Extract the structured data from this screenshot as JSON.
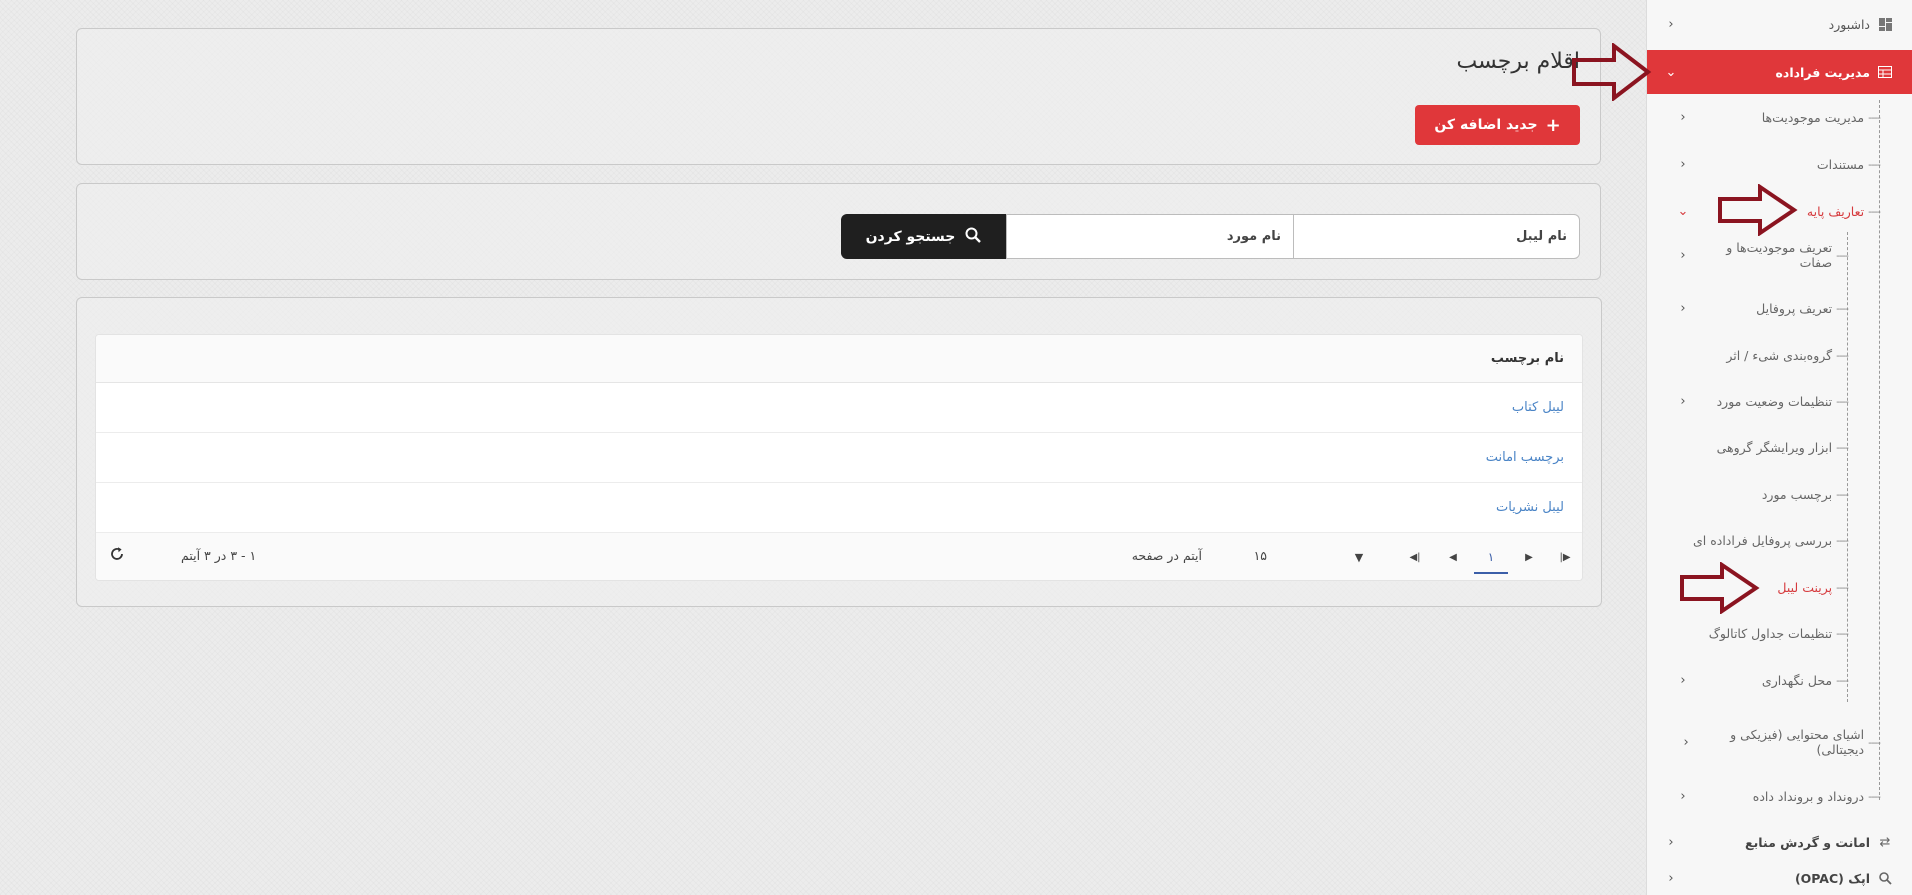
{
  "sidebar": {
    "dashboard": "داشبورد",
    "metadata": "مدیریت فراداده",
    "entity_mgmt": "مدیریت موجودیت‌ها",
    "documents": "مستندات",
    "basic_defs": "تعاریف پایه",
    "sub": {
      "entity_defs": "تعریف موجودیت‌ها و صفات",
      "profile_def": "تعریف پروفایل",
      "object_grouping": "گروه‌بندی شیء / اثر",
      "item_status": "تنظیمات وضعیت مورد",
      "bulk_editor": "ابزار ویرایشگر گروهی",
      "item_label": "برچسب مورد",
      "profile_review": "بررسی پروفایل فراداده ای",
      "label_print": "پرینت لیبل",
      "catalog_tables": "تنظیمات جداول کاتالوگ",
      "storage": "محل نگهداری"
    },
    "content_objects": "اشیای محتوایی (فیزیکی و دیجیتالی)",
    "data_io": "درونداد و برونداد داده",
    "circulation": "امانت و گردش منابع",
    "opac": "اپک (OPAC)"
  },
  "header": {
    "title": "اقلام برچسب",
    "add_button": "جدید اضافه کن"
  },
  "search": {
    "label_name_placeholder": "نام لیبل",
    "item_name_placeholder": "نام مورد",
    "button": "جستجو کردن"
  },
  "table": {
    "column": "نام برچسب",
    "rows": [
      "لیبل کتاب",
      "برچسب امانت",
      "لیبل نشریات"
    ]
  },
  "pager": {
    "current_page": "۱",
    "page_size": "۱۵",
    "items_per_page": "آیتم در صفحه",
    "range": "۱ - ۳ در ۳ آیتم"
  },
  "colors": {
    "accent": "#e0373a",
    "link": "#4a84c6",
    "arrow": "#8b1420"
  }
}
